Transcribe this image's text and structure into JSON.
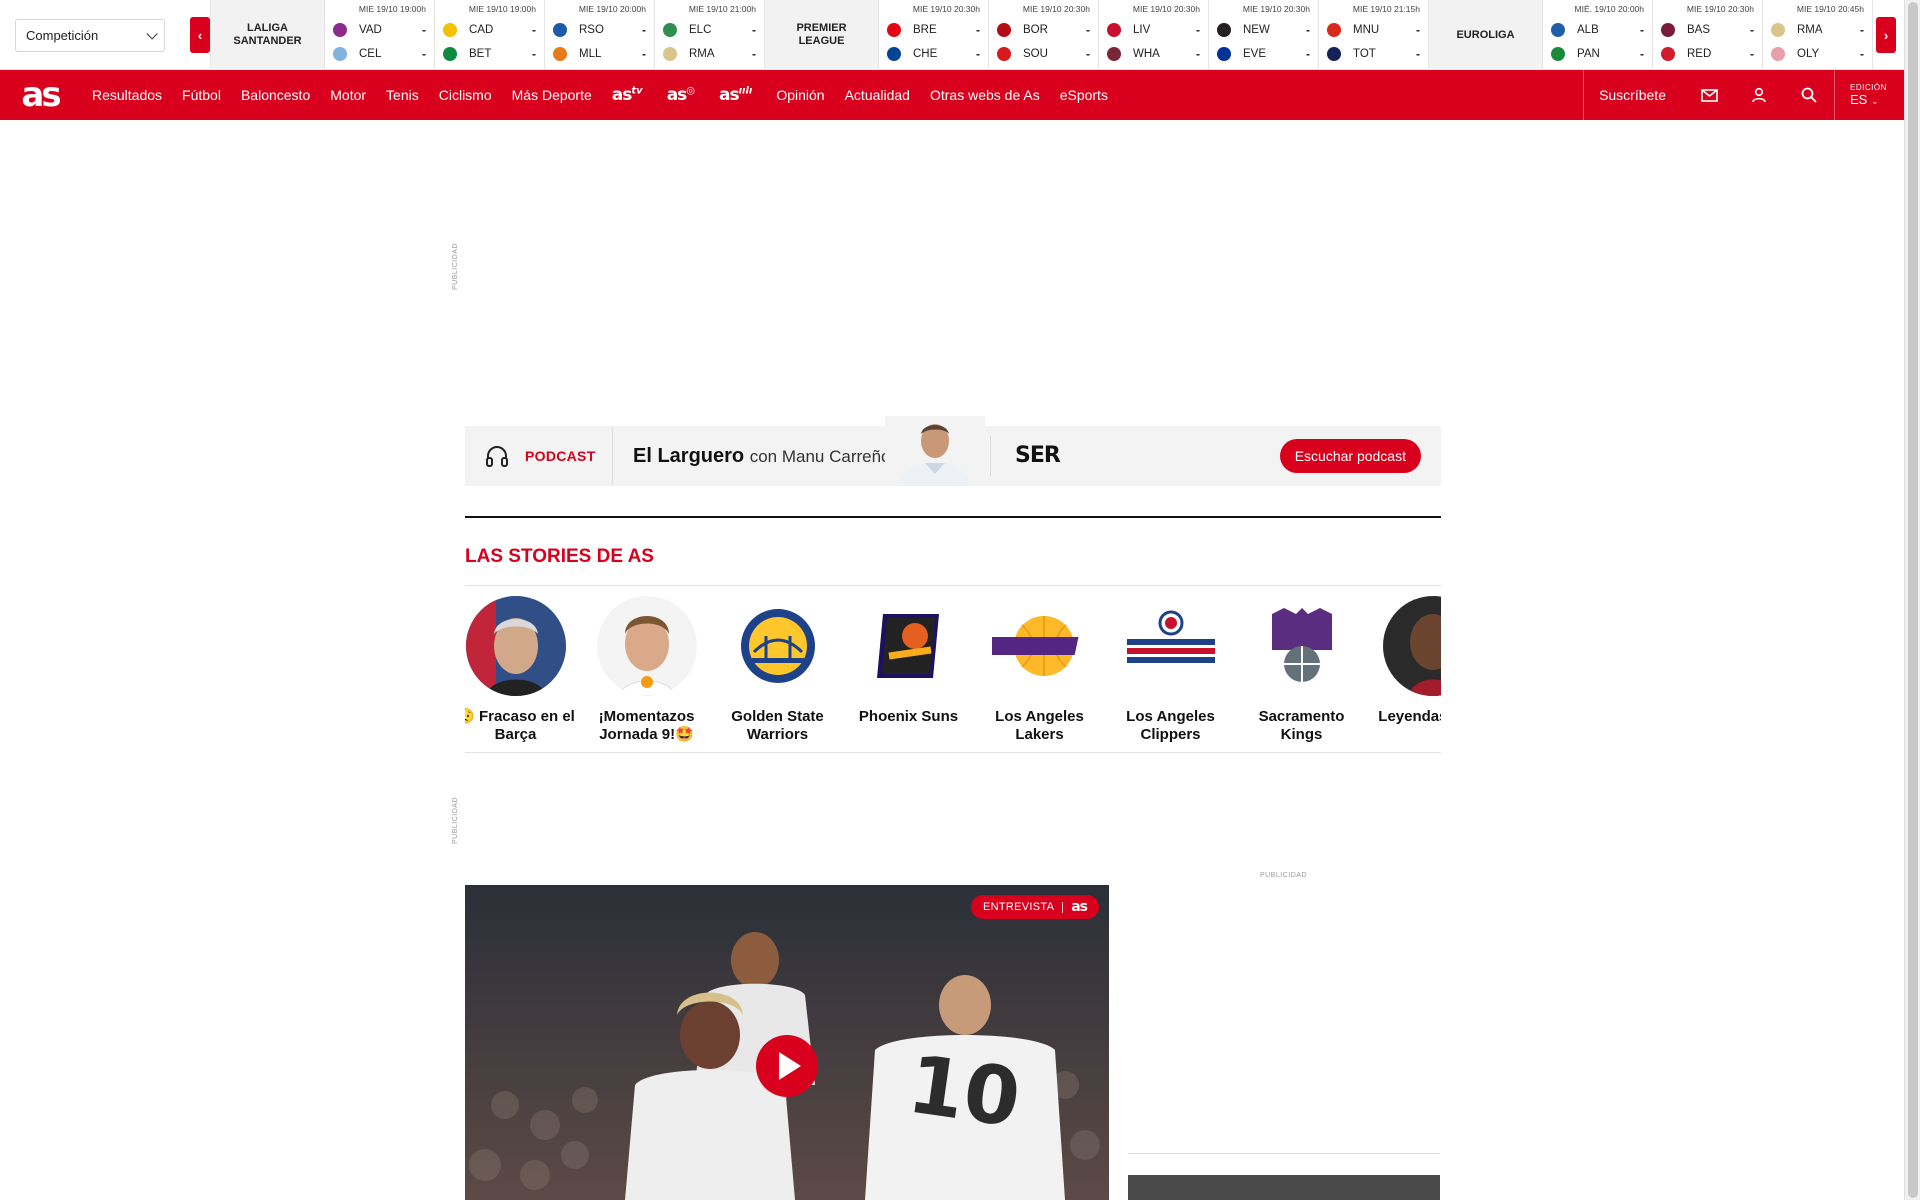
{
  "scores_bar": {
    "competition_select": "Competición",
    "groups": [
      {
        "league": [
          "LALIGA",
          "SANTANDER"
        ],
        "matches": [
          {
            "date": "MIE 19/10 19:00h",
            "home": "VAD",
            "away": "CEL",
            "home_score": "-",
            "away_score": "-"
          },
          {
            "date": "MIE 19/10 19:00h",
            "home": "CAD",
            "away": "BET",
            "home_score": "-",
            "away_score": "-"
          },
          {
            "date": "MIE 19/10 20:00h",
            "home": "RSO",
            "away": "MLL",
            "home_score": "-",
            "away_score": "-"
          },
          {
            "date": "MIE 19/10 21:00h",
            "home": "ELC",
            "away": "RMA",
            "home_score": "-",
            "away_score": "-"
          }
        ]
      },
      {
        "league": [
          "PREMIER",
          "LEAGUE"
        ],
        "matches": [
          {
            "date": "MIE 19/10 20:30h",
            "home": "BRE",
            "away": "CHE",
            "home_score": "-",
            "away_score": "-"
          },
          {
            "date": "MIE 19/10 20:30h",
            "home": "BOR",
            "away": "SOU",
            "home_score": "-",
            "away_score": "-"
          },
          {
            "date": "MIE 19/10 20:30h",
            "home": "LIV",
            "away": "WHA",
            "home_score": "-",
            "away_score": "-"
          },
          {
            "date": "MIE 19/10 20:30h",
            "home": "NEW",
            "away": "EVE",
            "home_score": "-",
            "away_score": "-"
          },
          {
            "date": "MIE 19/10 21:15h",
            "home": "MNU",
            "away": "TOT",
            "home_score": "-",
            "away_score": "-"
          }
        ]
      },
      {
        "league": [
          "EUROLIGA"
        ],
        "matches": [
          {
            "date": "MIÉ. 19/10 20:00h",
            "home": "ALB",
            "away": "PAN",
            "home_score": "-",
            "away_score": "-"
          },
          {
            "date": "MIE 19/10 20:30h",
            "home": "BAS",
            "away": "RED",
            "home_score": "-",
            "away_score": "-"
          },
          {
            "date": "MIE 19/10 20:45h",
            "home": "RMA",
            "away": "OLY",
            "home_score": "-",
            "away_score": "-"
          }
        ]
      }
    ]
  },
  "nav": {
    "logo": "as",
    "items": [
      "Resultados",
      "Fútbol",
      "Baloncesto",
      "Motor",
      "Tenis",
      "Ciclismo",
      "Más Deporte"
    ],
    "brands": [
      {
        "text": "as",
        "suffix": "tv"
      },
      {
        "text": "as",
        "suffix": "◎"
      },
      {
        "text": "as",
        "suffix": "ıılı"
      }
    ],
    "items_after": [
      "Opinión",
      "Actualidad",
      "Otras webs de As",
      "eSports"
    ],
    "subscribe": "Suscríbete",
    "edition_label": "EDICIÓN",
    "edition_value": "ES"
  },
  "ads": {
    "label": "PUBLICIDAD"
  },
  "podcast": {
    "tag": "PODCAST",
    "title": "El Larguero",
    "subtitle": "con Manu Carreño",
    "network": "SER",
    "button": "Escuchar podcast"
  },
  "stories": {
    "title": "LAS STORIES DE AS",
    "items": [
      {
        "caption": "😥 Fracaso en el Barça"
      },
      {
        "caption": "¡Momentazos Jornada 9!🤩"
      },
      {
        "caption": "Golden State Warriors"
      },
      {
        "caption": "Phoenix Suns"
      },
      {
        "caption": "Los Angeles Lakers"
      },
      {
        "caption": "Los Angeles Clippers"
      },
      {
        "caption": "Sacramento Kings"
      },
      {
        "caption": "Leyendas mate"
      }
    ]
  },
  "video": {
    "badge_label": "ENTREVISTA",
    "badge_brand": "as"
  },
  "colors": {
    "brand": "#d8001c"
  }
}
